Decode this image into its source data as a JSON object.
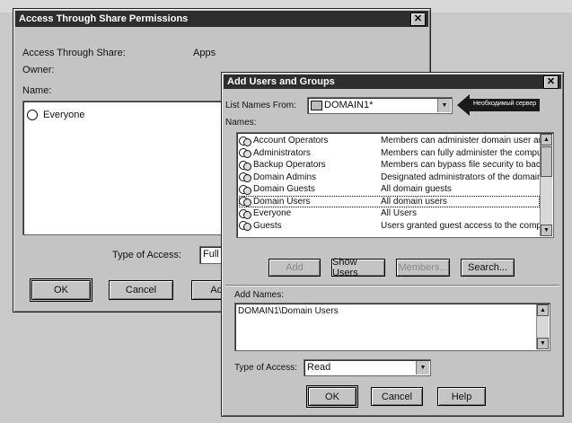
{
  "share_dialog": {
    "title": "Access Through Share Permissions",
    "access_through_share_label": "Access Through Share:",
    "access_through_share_value": "Apps",
    "owner_label": "Owner:",
    "name_label": "Name:",
    "names": [
      "Everyone"
    ],
    "type_of_access_label": "Type of Access:",
    "type_of_access_value": "Full",
    "buttons": {
      "ok": "OK",
      "cancel": "Cancel",
      "add": "Add"
    }
  },
  "add_dialog": {
    "title": "Add Users and Groups",
    "list_names_from_label": "List Names From:",
    "list_names_from_value": "DOMAIN1*",
    "callout_text": "Необходимый сервер",
    "names_label": "Names:",
    "names": [
      {
        "name": "Account Operators",
        "description": "Members can administer domain user an"
      },
      {
        "name": "Administrators",
        "description": "Members can fully administer the comput"
      },
      {
        "name": "Backup Operators",
        "description": "Members can bypass file security to back"
      },
      {
        "name": "Domain Admins",
        "description": "Designated administrators of the domain"
      },
      {
        "name": "Domain Guests",
        "description": "All domain guests"
      },
      {
        "name": "Domain Users",
        "description": "All domain users"
      },
      {
        "name": "Everyone",
        "description": "All Users"
      },
      {
        "name": "Guests",
        "description": "Users granted guest access to the comp"
      }
    ],
    "buttons": {
      "add": "Add",
      "show_users": "Show Users",
      "members": "Members...",
      "search": "Search...",
      "ok": "OK",
      "cancel": "Cancel",
      "help": "Help"
    },
    "add_names_label": "Add Names:",
    "add_names_value": "DOMAIN1\\Domain Users",
    "type_of_access_label": "Type of Access:",
    "type_of_access_value": "Read"
  }
}
